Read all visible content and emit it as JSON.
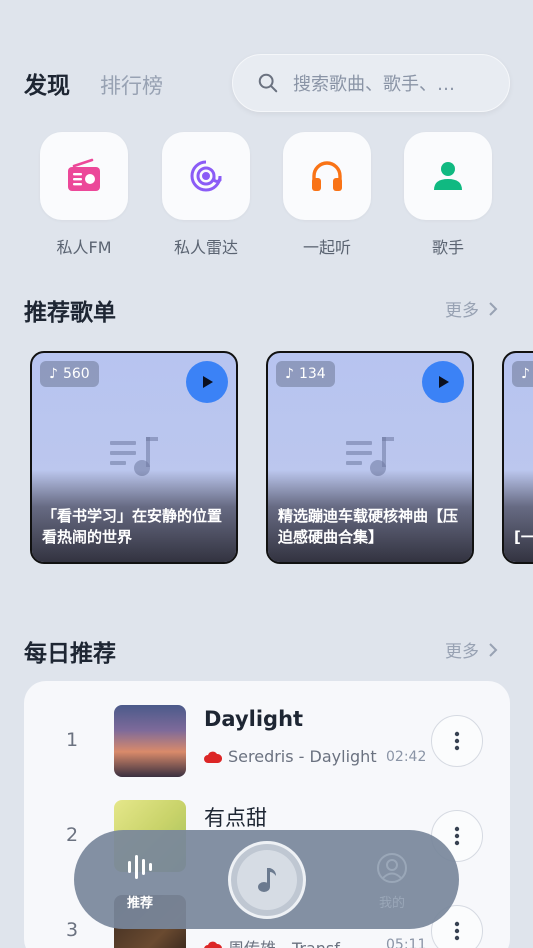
{
  "header": {
    "tab_active": "发现",
    "tab_inactive": "排行榜",
    "search_placeholder": "搜索歌曲、歌手、…"
  },
  "quick_access": [
    {
      "label": "私人FM",
      "icon": "radio-icon",
      "color": "#ec4899"
    },
    {
      "label": "私人雷达",
      "icon": "radar-icon",
      "color": "#8b5cf6"
    },
    {
      "label": "一起听",
      "icon": "headphones-icon",
      "color": "#f97316"
    },
    {
      "label": "歌手",
      "icon": "person-icon",
      "color": "#10b981"
    }
  ],
  "playlists_section": {
    "title": "推荐歌单",
    "more": "更多",
    "cards": [
      {
        "count": "560",
        "title": "「看书学习」在安静的位置看热闹的世界"
      },
      {
        "count": "134",
        "title": "精选蹦迪车载硬核神曲【压迫感硬曲合集】"
      },
      {
        "count": "",
        "title": "[一 你"
      }
    ]
  },
  "daily_section": {
    "title": "每日推荐",
    "more": "更多",
    "songs": [
      {
        "rank": "1",
        "title": "Daylight",
        "artist": "Seredris - Daylight",
        "duration": "02:42"
      },
      {
        "rank": "2",
        "title": "有点甜",
        "artist": "",
        "duration": ""
      },
      {
        "rank": "3",
        "title": "",
        "artist": "周传雄 - Transf",
        "duration": "05:11"
      }
    ]
  },
  "bottom_nav": {
    "recommend_label": "推荐",
    "mine_label": "我的"
  },
  "colors": {
    "accent": "#3b82f6",
    "background": "#dfe4ec"
  }
}
